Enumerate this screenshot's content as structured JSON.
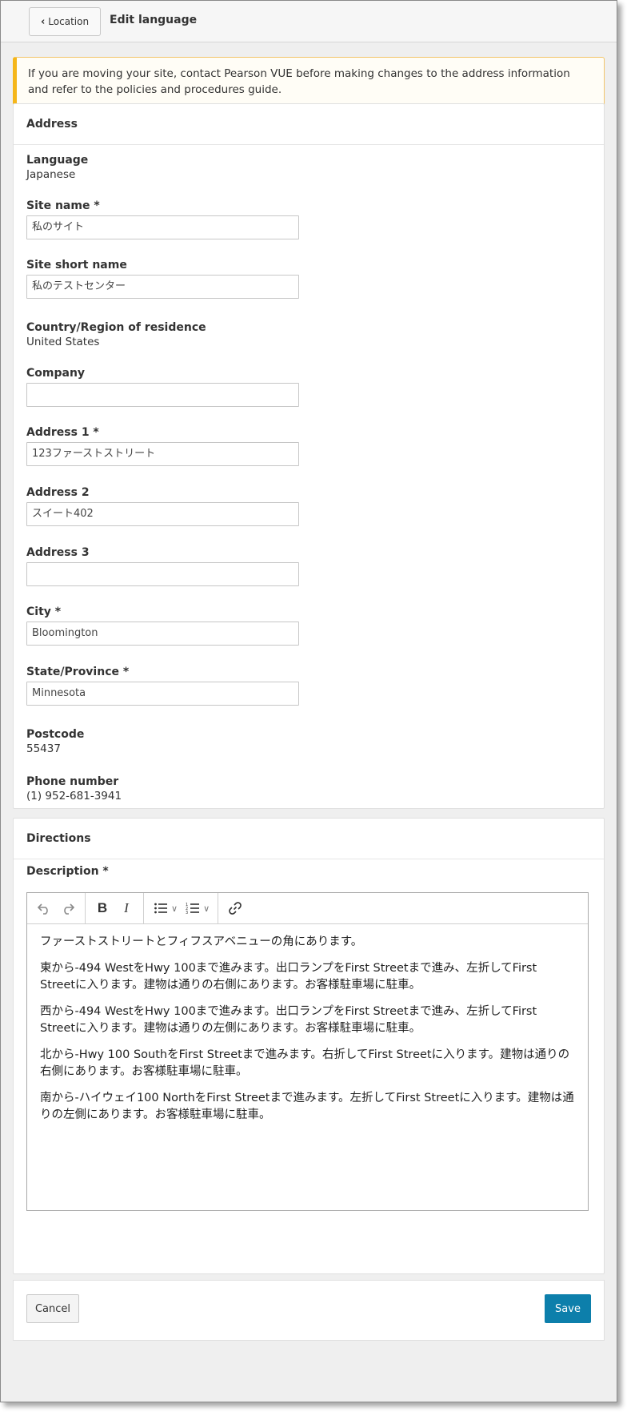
{
  "header": {
    "back_label": "Location",
    "title": "Edit language"
  },
  "alert": {
    "text": "If you are moving your site, contact Pearson VUE before making changes to the address information and refer to the policies and procedures guide."
  },
  "address": {
    "heading": "Address",
    "language_label": "Language",
    "language_value": "Japanese",
    "site_name_label": "Site name *",
    "site_name_value": "私のサイト",
    "site_short_name_label": "Site short name",
    "site_short_name_value": "私のテストセンター",
    "country_label": "Country/Region of residence",
    "country_value": "United States",
    "company_label": "Company",
    "company_value": "",
    "address1_label": "Address 1 *",
    "address1_value": "123ファーストストリート",
    "address2_label": "Address 2",
    "address2_value": "スイート402",
    "address3_label": "Address 3",
    "address3_value": "",
    "city_label": "City *",
    "city_value": "Bloomington",
    "state_label": "State/Province *",
    "state_value": "Minnesota",
    "postcode_label": "Postcode",
    "postcode_value": "55437",
    "phone_label": "Phone number",
    "phone_value": "(1) 952-681-3941"
  },
  "directions": {
    "heading": "Directions",
    "description_label": "Description *",
    "toolbar_icons": [
      "undo-icon",
      "redo-icon",
      "bold-icon",
      "italic-icon",
      "bullet-list-icon",
      "numbered-list-icon",
      "link-icon"
    ],
    "paragraphs": [
      "ファーストストリートとフィフスアベニューの角にあります。",
      "東から-494 WestをHwy 100まで進みます。出口ランプをFirst Streetまで進み、左折してFirst Streetに入ります。建物は通りの右側にあります。お客様駐車場に駐車。",
      "西から-494 WestをHwy 100まで進みます。出口ランプをFirst Streetまで進み、左折してFirst Streetに入ります。建物は通りの左側にあります。お客様駐車場に駐車。",
      "北から-Hwy 100 SouthをFirst Streetまで進みます。右折してFirst Streetに入ります。建物は通りの右側にあります。お客様駐車場に駐車。",
      "南から-ハイウェイ100 NorthをFirst Streetまで進みます。左折してFirst Streetに入ります。建物は通りの左側にあります。お客様駐車場に駐車。"
    ]
  },
  "footer": {
    "cancel_label": "Cancel",
    "save_label": "Save"
  },
  "colors": {
    "alert_accent": "#f5b619",
    "primary_button": "#0d7fab"
  }
}
